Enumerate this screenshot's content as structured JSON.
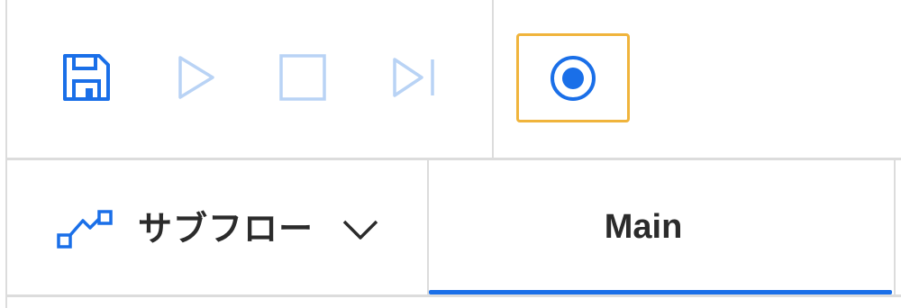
{
  "toolbar": {
    "buttons": [
      {
        "name": "save",
        "icon": "save-icon",
        "state": "enabled"
      },
      {
        "name": "run",
        "icon": "play-icon",
        "state": "disabled"
      },
      {
        "name": "stop",
        "icon": "stop-icon",
        "state": "disabled"
      },
      {
        "name": "run-next-action",
        "icon": "step-icon",
        "state": "disabled"
      },
      {
        "name": "recorder",
        "icon": "record-icon",
        "state": "highlighted"
      }
    ]
  },
  "tabs": {
    "subflows_label": "サブフロー",
    "subflows_icon": "subflow-icon",
    "items": [
      {
        "label": "Main",
        "selected": true
      }
    ]
  },
  "colors": {
    "accent": "#1a6fe8",
    "disabled_icon": "#b9d3f5",
    "highlight_border": "#f0b43c",
    "divider": "#dcdcdc",
    "text": "#2b2b2b"
  }
}
